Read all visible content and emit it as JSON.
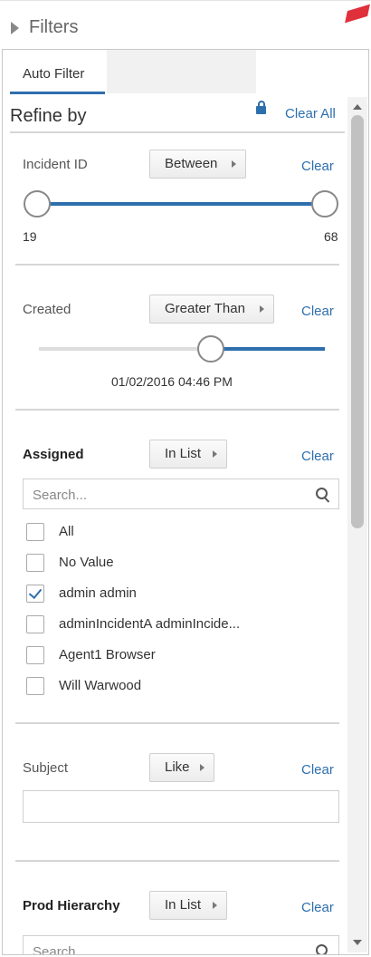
{
  "header": {
    "title": "Filters"
  },
  "tabs": [
    {
      "label": "Auto Filter",
      "active": true
    }
  ],
  "refine": {
    "title": "Refine by",
    "clear_all": "Clear All"
  },
  "filters": {
    "incident_id": {
      "label": "Incident ID",
      "operator": "Between",
      "clear": "Clear",
      "min": "19",
      "max": "68"
    },
    "created": {
      "label": "Created",
      "operator": "Greater Than",
      "clear": "Clear",
      "value": "01/02/2016 04:46 PM"
    },
    "assigned": {
      "label": "Assigned",
      "operator": "In List",
      "clear": "Clear",
      "search_placeholder": "Search...",
      "options": [
        {
          "label": "All",
          "checked": false
        },
        {
          "label": "No Value",
          "checked": false
        },
        {
          "label": "admin admin",
          "checked": true
        },
        {
          "label": "adminIncidentA adminIncide...",
          "checked": false
        },
        {
          "label": "Agent1 Browser",
          "checked": false
        },
        {
          "label": "Will Warwood",
          "checked": false
        }
      ]
    },
    "subject": {
      "label": "Subject",
      "operator": "Like",
      "clear": "Clear",
      "value": ""
    },
    "prod_hierarchy": {
      "label": "Prod Hierarchy",
      "operator": "In List",
      "clear": "Clear",
      "search_placeholder": "Search..."
    }
  },
  "colors": {
    "accent": "#2e6fad",
    "marker": "#e0303b"
  }
}
